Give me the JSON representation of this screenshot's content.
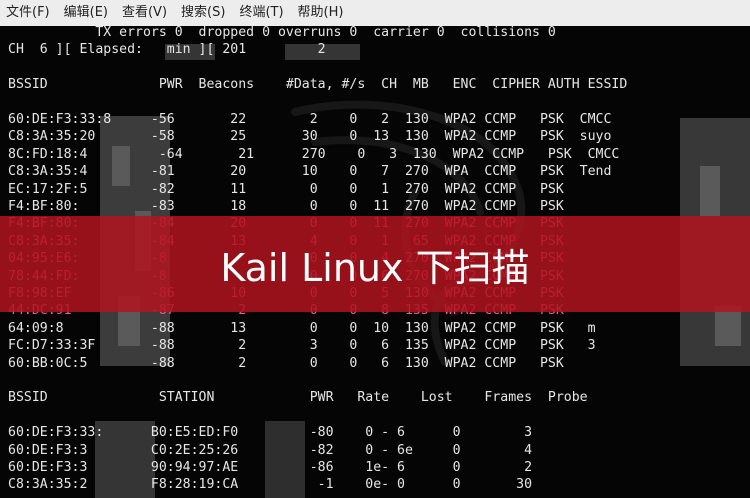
{
  "menu": [
    "文件(F)",
    "编辑(E)",
    "查看(V)",
    "搜索(S)",
    "终端(T)",
    "帮助(H)"
  ],
  "terminal_lines": [
    "           TX errors 0  dropped 0 overruns 0  carrier 0  collisions 0",
    "CH  6 ][ Elapsed:   min ][ 201         2",
    "",
    "BSSID              PWR  Beacons    #Data, #/s  CH  MB   ENC  CIPHER AUTH ESSID",
    "",
    "60:DE:F3:33:8     -56       22        2    0   2  130  WPA2 CCMP   PSK  CMCC",
    "C8:3A:35:20       -58       25       30    0  13  130  WPA2 CCMP   PSK  suyo",
    "8C:FD:18:4         -64       21      270    0   3  130  WPA2 CCMP   PSK  CMCC",
    "C8:3A:35:4        -81       20       10    0   7  270  WPA  CCMP   PSK  Tend",
    "EC:17:2F:5        -82       11        0    0   1  270  WPA2 CCMP   PSK",
    "F4:BF:80:         -83       18        0    0  11  270  WPA2 CCMP   PSK",
    "F4:BF:80:         -84       20        0    0  11  270  WPA2 CCMP   PSK",
    "C8:3A:35:         -84       13        4    0   1   65  WPA2 CCMP   PSK",
    "04:95:E6:         -8                  0    0   4  270  WPA2 CCMP   PSK",
    "78:44:FD:         -8                  0    0   6  270  WPA2 CCMP   PSK",
    "F8:98:EF          -86       10        0    0   5  130  WPA2 CCMP   PSK",
    "44:DC:91          -87        2        0    0   8  135  WPA2 CCMP   PSK",
    "64:09:8           -88       13        0    0  10  130  WPA2 CCMP   PSK   m",
    "FC:D7:33:3F       -88        2        3    0   6  135  WPA2 CCMP   PSK   3",
    "60:BB:0C:5        -88        2        0    0   6  130  WPA2 CCMP   PSK",
    "",
    "BSSID              STATION            PWR   Rate    Lost    Frames  Probe",
    "",
    "60:DE:F3:33:      B0:E5:ED:F0         -80    0 - 6      0        3",
    "60:DE:F3:3        C0:2E:25:26         -82    0 - 6e     0        4",
    "60:DE:F3:3        90:94:97:AE         -86    1e- 6      0        2",
    "C8:3A:35:2        F8:28:19:CA          -1    0e- 0      0       30"
  ],
  "overlay_title": "Kail Linux 下扫描"
}
